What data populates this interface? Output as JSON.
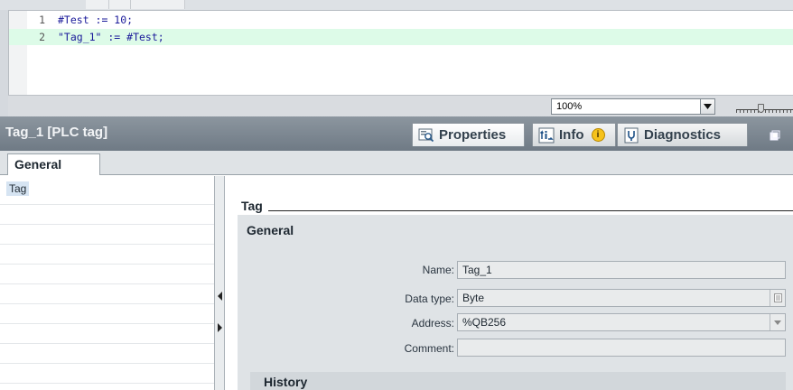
{
  "editor": {
    "lines": [
      {
        "number": "1",
        "text": "#Test := 10;"
      },
      {
        "number": "2",
        "text": "\"Tag_1\" := #Test;"
      }
    ],
    "zoom": "100%"
  },
  "inspector": {
    "title": "Tag_1 [PLC tag]",
    "tabs": {
      "properties": "Properties",
      "info": "Info",
      "info_badge": "i",
      "diagnostics": "Diagnostics"
    }
  },
  "subtabs": {
    "general": "General"
  },
  "nav": {
    "items": [
      "Tag"
    ]
  },
  "content": {
    "section_title": "Tag",
    "general_heading": "General",
    "fields": {
      "name": {
        "label": "Name:",
        "value": "Tag_1"
      },
      "data_type": {
        "label": "Data type:",
        "value": "Byte"
      },
      "address": {
        "label": "Address:",
        "value": "%QB256"
      },
      "comment": {
        "label": "Comment:",
        "value": ""
      }
    },
    "history_heading": "History"
  },
  "colors": {
    "inspector_bar": "#7d8790",
    "highlight_line": "#ddfbe8",
    "panel_gray": "#dfe3e6",
    "info_badge": "#f6c21b"
  }
}
